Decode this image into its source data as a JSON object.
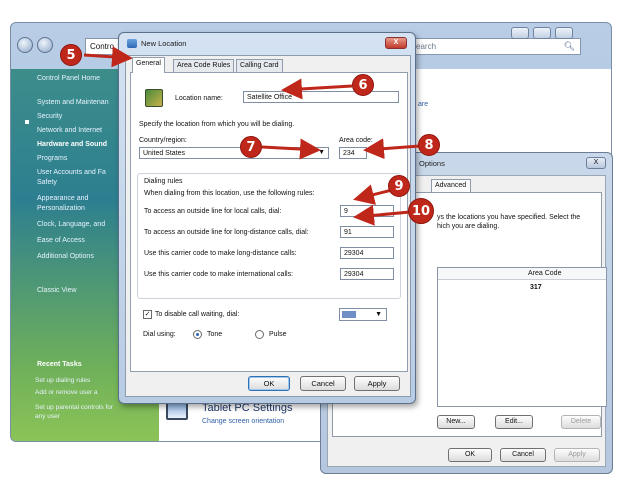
{
  "control_panel": {
    "address_text": "Contro",
    "search_placeholder": "earch",
    "sidebar": [
      {
        "label": "Control Panel Home",
        "style": "normal"
      },
      {
        "label": "System and Maintenan",
        "style": "normal"
      },
      {
        "label": "Security",
        "style": "normal"
      },
      {
        "label": "Network and Internet",
        "style": "normal"
      },
      {
        "label": "Hardware and Sound",
        "style": "bold"
      },
      {
        "label": "Programs",
        "style": "normal"
      },
      {
        "label": "User Accounts and Fa",
        "style": "normal"
      },
      {
        "label": "Safety",
        "style": "normal"
      },
      {
        "label": "Appearance and",
        "style": "normal"
      },
      {
        "label": "Personalization",
        "style": "normal"
      },
      {
        "label": "Clock, Language, and",
        "style": "normal"
      },
      {
        "label": "Ease of Access",
        "style": "normal"
      },
      {
        "label": "Additional Options",
        "style": "normal"
      },
      {
        "label": "Classic View",
        "style": "normal"
      }
    ],
    "recent_tasks_heading": "Recent Tasks",
    "recent_tasks": [
      "Set up dialing rules",
      "Add or remove user a",
      "Set up parental controls for",
      "any user"
    ],
    "tablet_title": "Tablet PC Settings",
    "tablet_subtitle": "Change screen orientation",
    "right_link": "are"
  },
  "phone_modem": {
    "title": "Options",
    "close_label": "X",
    "tab_advanced": "Advanced",
    "description": "ys the locations you have specified. Select the\nhich you are dialing.",
    "column_area_code": "Area Code",
    "area_code_value": "317",
    "buttons": {
      "new": "New...",
      "edit": "Edit...",
      "delete": "Delete",
      "ok": "OK",
      "cancel": "Cancel",
      "apply": "Apply"
    }
  },
  "new_location": {
    "title": "New Location",
    "close_label": "X",
    "tabs": [
      "General",
      "Area Code Rules",
      "Calling Card"
    ],
    "location_name_label": "Location name:",
    "location_name_value": "Satellite Office",
    "instruction": "Specify the location from which you will be dialing.",
    "country_label": "Country/region:",
    "country_value": "United States",
    "area_code_label": "Area code:",
    "area_code_value": "234",
    "dialing_rules_heading": "Dialing rules",
    "dialing_rules_intro": "When dialing from this location, use the following rules:",
    "rules": [
      {
        "label": "To access an outside line for local calls, dial:",
        "value": "9"
      },
      {
        "label": "To access an outside line for long-distance calls, dial:",
        "value": "91"
      },
      {
        "label": "Use this carrier code to make long-distance calls:",
        "value": "29304"
      },
      {
        "label": "Use this carrier code to make international calls:",
        "value": "29304"
      }
    ],
    "call_waiting_label": "To disable call waiting, dial:",
    "call_waiting_checked": true,
    "dial_using_label": "Dial using:",
    "tone_label": "Tone",
    "pulse_label": "Pulse",
    "dial_mode": "Tone",
    "buttons": {
      "ok": "OK",
      "cancel": "Cancel",
      "apply": "Apply"
    }
  },
  "callouts": [
    "5",
    "6",
    "7",
    "8",
    "9",
    "10"
  ],
  "colors": {
    "callout": "#c0271b",
    "sidebar_top": "#3c8d8a",
    "sidebar_bottom": "#8cc457",
    "title_bar": "#c9d8ea",
    "link": "#2f5fa6"
  }
}
